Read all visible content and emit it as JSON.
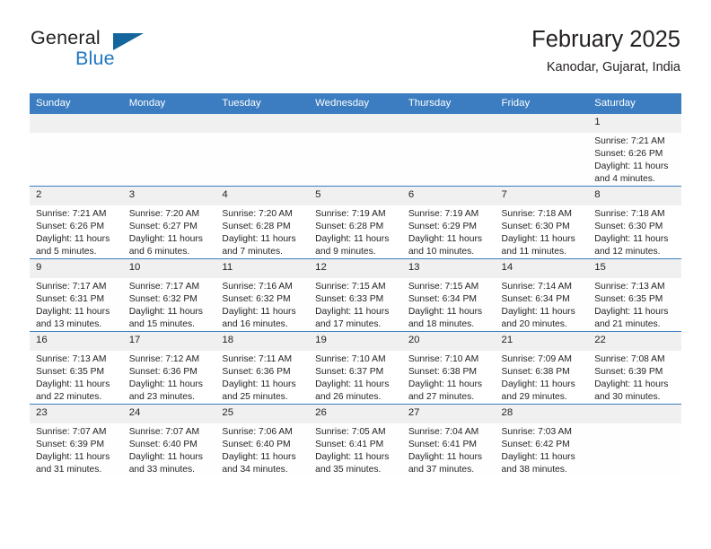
{
  "brand": {
    "name_part1": "General",
    "name_part2": "Blue",
    "accent_color": "#2077c1",
    "triangle_color": "#14659e"
  },
  "header": {
    "title": "February 2025",
    "subtitle": "Kanodar, Gujarat, India"
  },
  "calendar": {
    "header_bg": "#3b7dc0",
    "daynum_bg": "#f0f0f0",
    "weekday_headers": [
      "Sunday",
      "Monday",
      "Tuesday",
      "Wednesday",
      "Thursday",
      "Friday",
      "Saturday"
    ],
    "weeks": [
      [
        {
          "day": "",
          "empty": true
        },
        {
          "day": "",
          "empty": true
        },
        {
          "day": "",
          "empty": true
        },
        {
          "day": "",
          "empty": true
        },
        {
          "day": "",
          "empty": true
        },
        {
          "day": "",
          "empty": true
        },
        {
          "day": "1",
          "sunrise": "Sunrise: 7:21 AM",
          "sunset": "Sunset: 6:26 PM",
          "daylight": "Daylight: 11 hours and 4 minutes."
        }
      ],
      [
        {
          "day": "2",
          "sunrise": "Sunrise: 7:21 AM",
          "sunset": "Sunset: 6:26 PM",
          "daylight": "Daylight: 11 hours and 5 minutes."
        },
        {
          "day": "3",
          "sunrise": "Sunrise: 7:20 AM",
          "sunset": "Sunset: 6:27 PM",
          "daylight": "Daylight: 11 hours and 6 minutes."
        },
        {
          "day": "4",
          "sunrise": "Sunrise: 7:20 AM",
          "sunset": "Sunset: 6:28 PM",
          "daylight": "Daylight: 11 hours and 7 minutes."
        },
        {
          "day": "5",
          "sunrise": "Sunrise: 7:19 AM",
          "sunset": "Sunset: 6:28 PM",
          "daylight": "Daylight: 11 hours and 9 minutes."
        },
        {
          "day": "6",
          "sunrise": "Sunrise: 7:19 AM",
          "sunset": "Sunset: 6:29 PM",
          "daylight": "Daylight: 11 hours and 10 minutes."
        },
        {
          "day": "7",
          "sunrise": "Sunrise: 7:18 AM",
          "sunset": "Sunset: 6:30 PM",
          "daylight": "Daylight: 11 hours and 11 minutes."
        },
        {
          "day": "8",
          "sunrise": "Sunrise: 7:18 AM",
          "sunset": "Sunset: 6:30 PM",
          "daylight": "Daylight: 11 hours and 12 minutes."
        }
      ],
      [
        {
          "day": "9",
          "sunrise": "Sunrise: 7:17 AM",
          "sunset": "Sunset: 6:31 PM",
          "daylight": "Daylight: 11 hours and 13 minutes."
        },
        {
          "day": "10",
          "sunrise": "Sunrise: 7:17 AM",
          "sunset": "Sunset: 6:32 PM",
          "daylight": "Daylight: 11 hours and 15 minutes."
        },
        {
          "day": "11",
          "sunrise": "Sunrise: 7:16 AM",
          "sunset": "Sunset: 6:32 PM",
          "daylight": "Daylight: 11 hours and 16 minutes."
        },
        {
          "day": "12",
          "sunrise": "Sunrise: 7:15 AM",
          "sunset": "Sunset: 6:33 PM",
          "daylight": "Daylight: 11 hours and 17 minutes."
        },
        {
          "day": "13",
          "sunrise": "Sunrise: 7:15 AM",
          "sunset": "Sunset: 6:34 PM",
          "daylight": "Daylight: 11 hours and 18 minutes."
        },
        {
          "day": "14",
          "sunrise": "Sunrise: 7:14 AM",
          "sunset": "Sunset: 6:34 PM",
          "daylight": "Daylight: 11 hours and 20 minutes."
        },
        {
          "day": "15",
          "sunrise": "Sunrise: 7:13 AM",
          "sunset": "Sunset: 6:35 PM",
          "daylight": "Daylight: 11 hours and 21 minutes."
        }
      ],
      [
        {
          "day": "16",
          "sunrise": "Sunrise: 7:13 AM",
          "sunset": "Sunset: 6:35 PM",
          "daylight": "Daylight: 11 hours and 22 minutes."
        },
        {
          "day": "17",
          "sunrise": "Sunrise: 7:12 AM",
          "sunset": "Sunset: 6:36 PM",
          "daylight": "Daylight: 11 hours and 23 minutes."
        },
        {
          "day": "18",
          "sunrise": "Sunrise: 7:11 AM",
          "sunset": "Sunset: 6:36 PM",
          "daylight": "Daylight: 11 hours and 25 minutes."
        },
        {
          "day": "19",
          "sunrise": "Sunrise: 7:10 AM",
          "sunset": "Sunset: 6:37 PM",
          "daylight": "Daylight: 11 hours and 26 minutes."
        },
        {
          "day": "20",
          "sunrise": "Sunrise: 7:10 AM",
          "sunset": "Sunset: 6:38 PM",
          "daylight": "Daylight: 11 hours and 27 minutes."
        },
        {
          "day": "21",
          "sunrise": "Sunrise: 7:09 AM",
          "sunset": "Sunset: 6:38 PM",
          "daylight": "Daylight: 11 hours and 29 minutes."
        },
        {
          "day": "22",
          "sunrise": "Sunrise: 7:08 AM",
          "sunset": "Sunset: 6:39 PM",
          "daylight": "Daylight: 11 hours and 30 minutes."
        }
      ],
      [
        {
          "day": "23",
          "sunrise": "Sunrise: 7:07 AM",
          "sunset": "Sunset: 6:39 PM",
          "daylight": "Daylight: 11 hours and 31 minutes."
        },
        {
          "day": "24",
          "sunrise": "Sunrise: 7:07 AM",
          "sunset": "Sunset: 6:40 PM",
          "daylight": "Daylight: 11 hours and 33 minutes."
        },
        {
          "day": "25",
          "sunrise": "Sunrise: 7:06 AM",
          "sunset": "Sunset: 6:40 PM",
          "daylight": "Daylight: 11 hours and 34 minutes."
        },
        {
          "day": "26",
          "sunrise": "Sunrise: 7:05 AM",
          "sunset": "Sunset: 6:41 PM",
          "daylight": "Daylight: 11 hours and 35 minutes."
        },
        {
          "day": "27",
          "sunrise": "Sunrise: 7:04 AM",
          "sunset": "Sunset: 6:41 PM",
          "daylight": "Daylight: 11 hours and 37 minutes."
        },
        {
          "day": "28",
          "sunrise": "Sunrise: 7:03 AM",
          "sunset": "Sunset: 6:42 PM",
          "daylight": "Daylight: 11 hours and 38 minutes."
        },
        {
          "day": "",
          "empty": true
        }
      ]
    ]
  }
}
